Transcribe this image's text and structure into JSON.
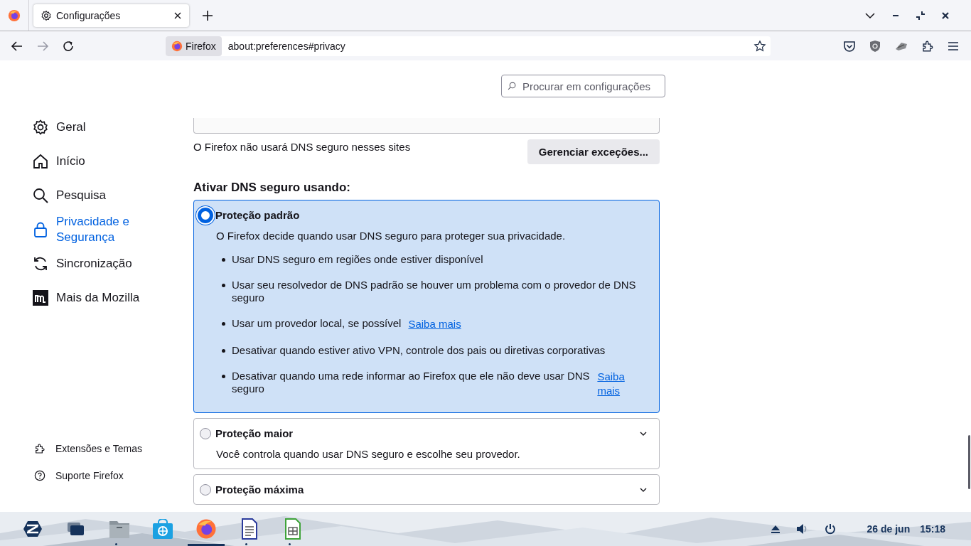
{
  "tabs": [
    {
      "label": "Configurações",
      "selected": true
    }
  ],
  "address_bar": {
    "identity": "Firefox",
    "url": "about:preferences#privacy"
  },
  "search": {
    "placeholder": "Procurar em configurações"
  },
  "sidebar": {
    "items": [
      {
        "label": "Geral",
        "kind": "gear",
        "selected": false
      },
      {
        "label": "Início",
        "kind": "home",
        "selected": false
      },
      {
        "label": "Pesquisa",
        "kind": "search",
        "selected": false
      },
      {
        "label": "Privacidade e Segurança",
        "kind": "lock",
        "selected": true
      },
      {
        "label": "Sincronização",
        "kind": "sync",
        "selected": false
      },
      {
        "label": "Mais da Mozilla",
        "kind": "mozilla",
        "selected": false
      }
    ],
    "footer": [
      {
        "label": "Extensões e Temas",
        "kind": "puzzle"
      },
      {
        "label": "Suporte Firefox",
        "kind": "help"
      }
    ]
  },
  "exceptions": {
    "text": "O Firefox não usará DNS seguro nesses sites",
    "button": "Gerenciar exceções..."
  },
  "dns_heading": "Ativar DNS seguro usando:",
  "options": [
    {
      "title": "Proteção padrão",
      "selected": true,
      "expanded": true,
      "description": "O Firefox decide quando usar DNS seguro para proteger sua privacidade.",
      "bullets": [
        {
          "text": "Usar DNS seguro em regiões onde estiver disponível"
        },
        {
          "text": "Usar seu resolvedor de DNS padrão se houver um problema com o provedor de DNS seguro"
        },
        {
          "text": "Usar um provedor local, se possível",
          "link": "Saiba mais"
        },
        {
          "text": "Desativar quando estiver ativo VPN, controle dos pais ou diretivas corporativas"
        },
        {
          "text": "Desativar quando uma rede informar ao Firefox que ele não deve usar DNS seguro",
          "link": "Saiba mais"
        }
      ]
    },
    {
      "title": "Proteção maior",
      "selected": false,
      "expanded": false,
      "description": "Você controla quando usar DNS seguro e escolhe seu provedor."
    },
    {
      "title": "Proteção máxima",
      "selected": false,
      "expanded": false
    }
  ],
  "taskbar": {
    "apps": [
      {
        "kind": "zorin",
        "running": false,
        "selected": false
      },
      {
        "kind": "windows",
        "running": false,
        "selected": false
      },
      {
        "kind": "files",
        "running": true,
        "selected": false
      },
      {
        "kind": "store",
        "running": false,
        "selected": false
      },
      {
        "kind": "firefox",
        "running": true,
        "selected": true
      },
      {
        "kind": "writer",
        "running": true,
        "selected": false
      },
      {
        "kind": "calc",
        "running": true,
        "selected": false
      }
    ],
    "date": "26 de jun",
    "time": "15:18"
  }
}
